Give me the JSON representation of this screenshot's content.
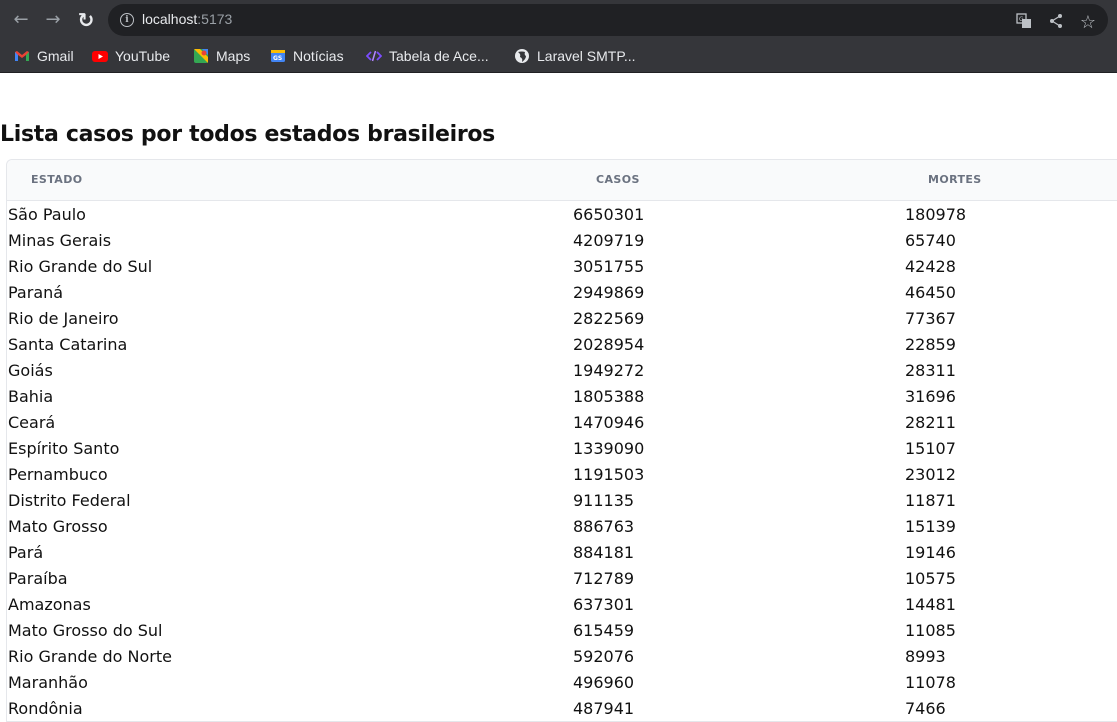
{
  "browser": {
    "url_host": "localhost",
    "url_port": ":5173",
    "bookmarks": [
      {
        "label": "Gmail",
        "icon": "gmail-icon"
      },
      {
        "label": "YouTube",
        "icon": "youtube-icon"
      },
      {
        "label": "Maps",
        "icon": "maps-icon"
      },
      {
        "label": "Notícias",
        "icon": "news-icon"
      },
      {
        "label": "Tabela de Ace...",
        "icon": "code-icon"
      },
      {
        "label": "Laravel SMTP...",
        "icon": "globe-icon"
      }
    ]
  },
  "page": {
    "title": "Lista casos por todos estados brasileiros"
  },
  "table": {
    "headers": {
      "estado": "ESTADO",
      "casos": "CASOS",
      "mortes": "MORTES"
    },
    "rows": [
      {
        "estado": "São Paulo",
        "casos": "6650301",
        "mortes": "180978"
      },
      {
        "estado": "Minas Gerais",
        "casos": "4209719",
        "mortes": "65740"
      },
      {
        "estado": "Rio Grande do Sul",
        "casos": "3051755",
        "mortes": "42428"
      },
      {
        "estado": "Paraná",
        "casos": "2949869",
        "mortes": "46450"
      },
      {
        "estado": "Rio de Janeiro",
        "casos": "2822569",
        "mortes": "77367"
      },
      {
        "estado": "Santa Catarina",
        "casos": "2028954",
        "mortes": "22859"
      },
      {
        "estado": "Goiás",
        "casos": "1949272",
        "mortes": "28311"
      },
      {
        "estado": "Bahia",
        "casos": "1805388",
        "mortes": "31696"
      },
      {
        "estado": "Ceará",
        "casos": "1470946",
        "mortes": "28211"
      },
      {
        "estado": "Espírito Santo",
        "casos": "1339090",
        "mortes": "15107"
      },
      {
        "estado": "Pernambuco",
        "casos": "1191503",
        "mortes": "23012"
      },
      {
        "estado": "Distrito Federal",
        "casos": "911135",
        "mortes": "11871"
      },
      {
        "estado": "Mato Grosso",
        "casos": "886763",
        "mortes": "15139"
      },
      {
        "estado": "Pará",
        "casos": "884181",
        "mortes": "19146"
      },
      {
        "estado": "Paraíba",
        "casos": "712789",
        "mortes": "10575"
      },
      {
        "estado": "Amazonas",
        "casos": "637301",
        "mortes": "14481"
      },
      {
        "estado": "Mato Grosso do Sul",
        "casos": "615459",
        "mortes": "11085"
      },
      {
        "estado": "Rio Grande do Norte",
        "casos": "592076",
        "mortes": "8993"
      },
      {
        "estado": "Maranhão",
        "casos": "496960",
        "mortes": "11078"
      },
      {
        "estado": "Rondônia",
        "casos": "487941",
        "mortes": "7466"
      }
    ]
  }
}
